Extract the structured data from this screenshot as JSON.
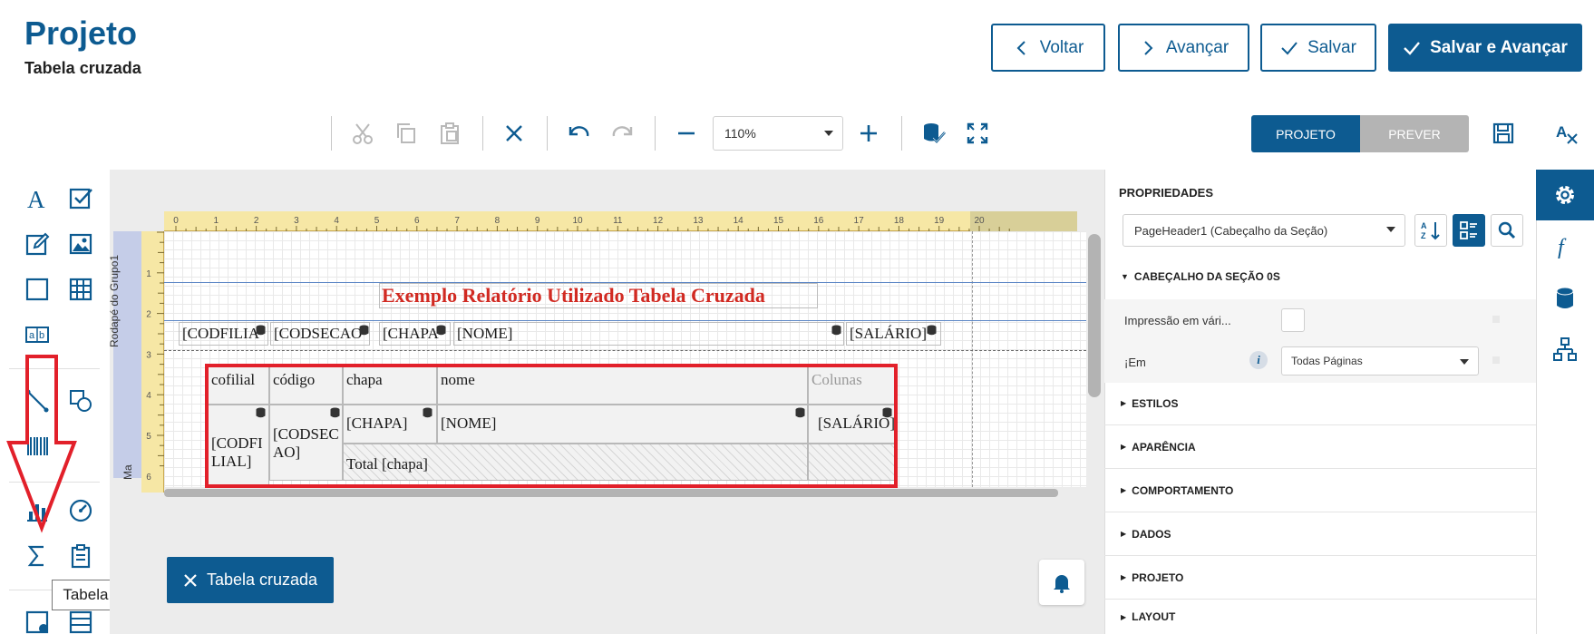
{
  "header": {
    "title": "Projeto",
    "subtitle": "Tabela cruzada",
    "buttons": {
      "back": "Voltar",
      "next": "Avançar",
      "save": "Salvar",
      "save_next": "Salvar e Avançar"
    }
  },
  "toolbar": {
    "zoom": "110%",
    "mode_design": "PROJETO",
    "mode_preview": "PREVER"
  },
  "ruler": {
    "h_ticks": [
      "0",
      "1",
      "2",
      "3",
      "4",
      "5",
      "6",
      "7",
      "8",
      "9",
      "10",
      "11",
      "12",
      "13",
      "14",
      "15",
      "16",
      "17",
      "18",
      "19",
      "20"
    ],
    "v_ticks": [
      "1",
      "2",
      "3",
      "4",
      "5",
      "6"
    ]
  },
  "band": {
    "label": "Rodapé do Grupo1",
    "label_cut": "Ma"
  },
  "report": {
    "title": "Exemplo Relatório Utilizado Tabela Cruzada",
    "fields": [
      "[CODFILIA",
      "[CODSECAO",
      "[CHAPA",
      "[NOME]",
      "[SALÁRIO]"
    ],
    "crosstab": {
      "headers": [
        "cofilial",
        "código",
        "chapa",
        "nome",
        "Colunas"
      ],
      "row_fields": [
        "[CODFI LIAL]",
        "[CODSEC AO]",
        "[CHAPA]",
        "[NOME]",
        "[SALÁRIO]"
      ],
      "total": "Total [chapa]"
    }
  },
  "toolbox": {
    "tooltip": "Tabela cruzada"
  },
  "selection_chip": "Tabela cruzada",
  "properties": {
    "title": "PROPRIEDADES",
    "component": "PageHeader1 (Cabeçalho da Seção)",
    "section_open": "CABEÇALHO DA SEÇÃO 0S",
    "print_on_all": "Impressão em vári...",
    "print_on": "¡Em",
    "print_on_value": "Todas Páginas",
    "sections": [
      "ESTILOS",
      "APARÊNCIA",
      "COMPORTAMENTO",
      "DADOS",
      "PROJETO",
      "LAYOUT"
    ]
  },
  "colors": {
    "brand": "#0d5b91",
    "annotation_red": "#e2202a",
    "title_red": "#d12a22"
  }
}
